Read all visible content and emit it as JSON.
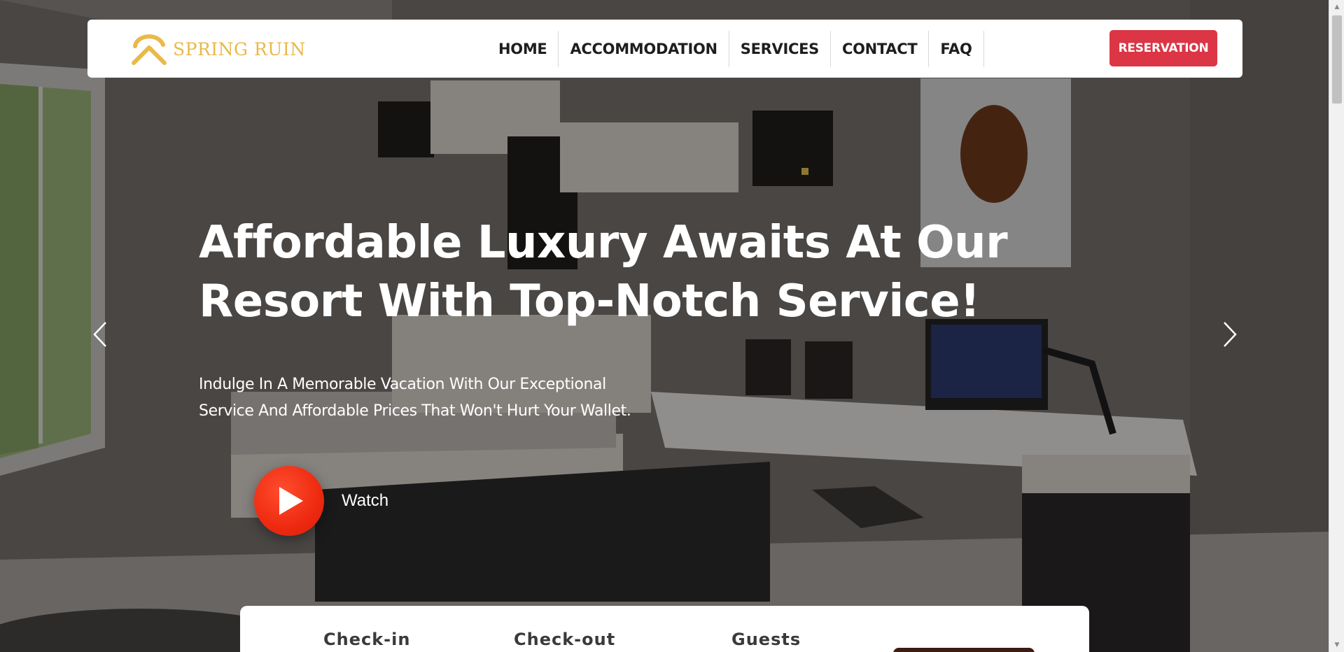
{
  "brand": {
    "name": "SPRING RUIN",
    "color": "#e9b949"
  },
  "nav": {
    "items": [
      {
        "label": "HOME"
      },
      {
        "label": "ACCOMMODATION"
      },
      {
        "label": "SERVICES"
      },
      {
        "label": "CONTACT"
      },
      {
        "label": "FAQ"
      }
    ],
    "reservation_label": "RESERVATION",
    "reservation_color": "#dc3545"
  },
  "hero": {
    "title": "Affordable Luxury Awaits At Our Resort With Top-Notch Service!",
    "subtitle_line1": "Indulge In A Memorable Vacation With Our Exceptional",
    "subtitle_line2": "Service And Affordable Prices That Won't Hurt Your Wallet.",
    "watch_label": "Watch",
    "play_color": "#ee2a10"
  },
  "booking": {
    "checkin_label": "Check-in",
    "checkout_label": "Check-out",
    "guests_label": "Guests"
  },
  "icons": {
    "prev": "chevron-left-icon",
    "next": "chevron-right-icon",
    "play": "play-icon",
    "logo": "roof-chevron-logo"
  }
}
